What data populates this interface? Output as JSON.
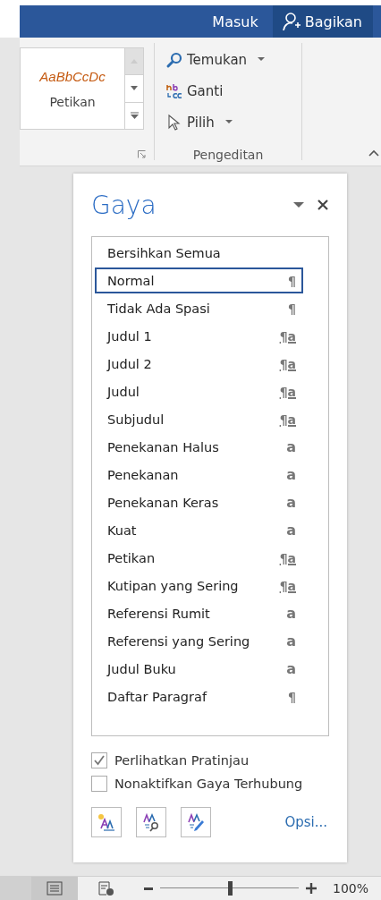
{
  "title_bar": {
    "sign_in": "Masuk",
    "share": "Bagikan"
  },
  "ribbon": {
    "gallery": {
      "preview": "AaBbCcDc",
      "label": "Petikan"
    },
    "editing": {
      "items": [
        {
          "kind": "find",
          "label": "Temukan",
          "dropdown": true
        },
        {
          "kind": "replace",
          "label": "Ganti",
          "dropdown": false
        },
        {
          "kind": "select",
          "label": "Pilih",
          "dropdown": true
        }
      ],
      "group_label": "Pengeditan"
    }
  },
  "styles_pane": {
    "title": "Gaya",
    "styles": [
      {
        "name": "Bersihkan Semua",
        "selected": false,
        "kind": "none"
      },
      {
        "name": "Normal",
        "selected": true,
        "kind": "paragraph",
        "symbol": "¶"
      },
      {
        "name": "Tidak Ada Spasi",
        "selected": false,
        "kind": "paragraph",
        "symbol": "¶"
      },
      {
        "name": "Judul 1",
        "selected": false,
        "kind": "linked",
        "symbol": "¶a"
      },
      {
        "name": "Judul 2",
        "selected": false,
        "kind": "linked",
        "symbol": "¶a"
      },
      {
        "name": "Judul",
        "selected": false,
        "kind": "linked",
        "symbol": "¶a"
      },
      {
        "name": "Subjudul",
        "selected": false,
        "kind": "linked",
        "symbol": "¶a"
      },
      {
        "name": "Penekanan Halus",
        "selected": false,
        "kind": "character",
        "symbol": "a"
      },
      {
        "name": "Penekanan",
        "selected": false,
        "kind": "character",
        "symbol": "a"
      },
      {
        "name": "Penekanan Keras",
        "selected": false,
        "kind": "character",
        "symbol": "a"
      },
      {
        "name": "Kuat",
        "selected": false,
        "kind": "character",
        "symbol": "a"
      },
      {
        "name": "Petikan",
        "selected": false,
        "kind": "linked",
        "symbol": "¶a"
      },
      {
        "name": "Kutipan yang Sering",
        "selected": false,
        "kind": "linked",
        "symbol": "¶a"
      },
      {
        "name": "Referensi Rumit",
        "selected": false,
        "kind": "character",
        "symbol": "a"
      },
      {
        "name": "Referensi yang Sering",
        "selected": false,
        "kind": "character",
        "symbol": "a"
      },
      {
        "name": "Judul Buku",
        "selected": false,
        "kind": "character",
        "symbol": "a"
      },
      {
        "name": "Daftar Paragraf",
        "selected": false,
        "kind": "paragraph",
        "symbol": "¶"
      }
    ],
    "options": [
      {
        "label": "Perlihatkan Pratinjau",
        "checked": true
      },
      {
        "label": "Nonaktifkan Gaya Terhubung",
        "checked": false
      }
    ],
    "options_link": "Opsi..."
  },
  "status_bar": {
    "views": [
      {
        "kind": "print",
        "selected": true
      },
      {
        "kind": "web",
        "selected": false
      }
    ],
    "zoom": {
      "level": 0.5,
      "reading": "100%"
    }
  }
}
